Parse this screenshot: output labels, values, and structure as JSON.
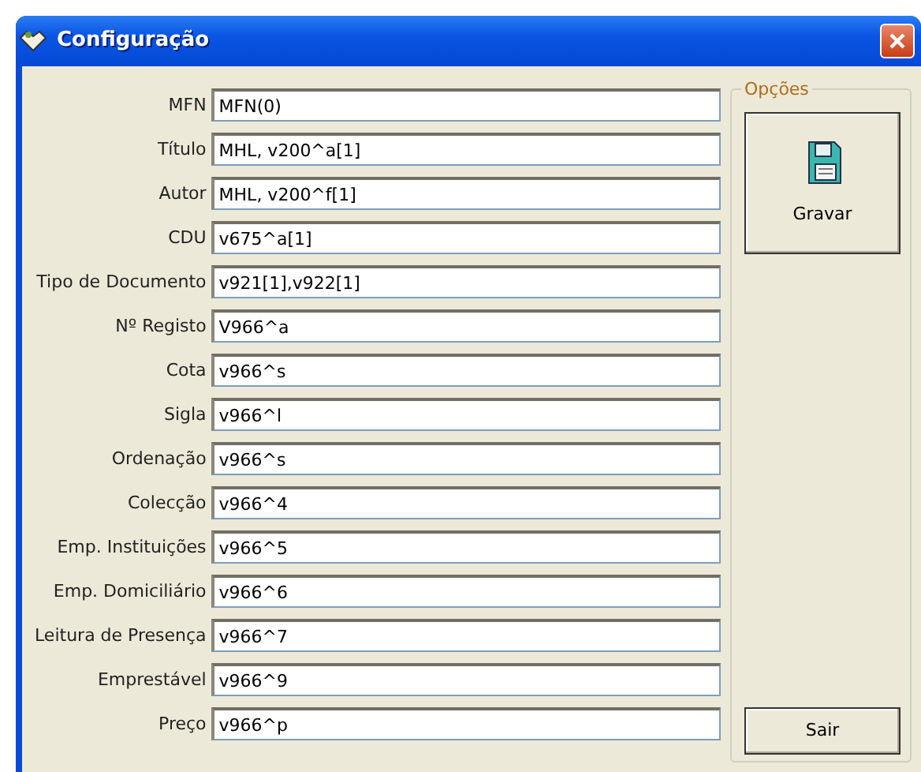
{
  "window": {
    "title": "Configuração"
  },
  "fields": [
    {
      "label": "MFN",
      "value": "MFN(0)"
    },
    {
      "label": "Título",
      "value": "MHL, v200^a[1]"
    },
    {
      "label": "Autor",
      "value": "MHL, v200^f[1]"
    },
    {
      "label": "CDU",
      "value": "v675^a[1]"
    },
    {
      "label": "Tipo de Documento",
      "value": "v921[1],v922[1]"
    },
    {
      "label": "Nº Registo",
      "value": "V966^a"
    },
    {
      "label": "Cota",
      "value": "v966^s"
    },
    {
      "label": "Sigla",
      "value": "v966^l"
    },
    {
      "label": "Ordenação",
      "value": "v966^s"
    },
    {
      "label": "Colecção",
      "value": "v966^4"
    },
    {
      "label": "Emp. Instituições",
      "value": "v966^5"
    },
    {
      "label": "Emp. Domiciliário",
      "value": "v966^6"
    },
    {
      "label": "Leitura de Presença",
      "value": "v966^7"
    },
    {
      "label": "Emprestável",
      "value": "v966^9"
    },
    {
      "label": "Preço",
      "value": "v966^p"
    }
  ],
  "options": {
    "title": "Opções",
    "save_button": "Gravar",
    "exit_button": "Sair"
  }
}
